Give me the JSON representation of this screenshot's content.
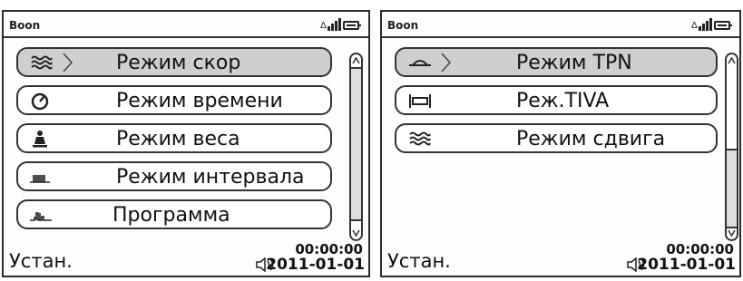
{
  "screens": [
    {
      "header": {
        "brand": "Boon"
      },
      "menu": [
        {
          "label": "Режим скор",
          "icon": "flow-waves-icon",
          "selected": true
        },
        {
          "label": "Режим времени",
          "icon": "timer-icon",
          "selected": false
        },
        {
          "label": "Режим веса",
          "icon": "person-weight-icon",
          "selected": false
        },
        {
          "label": "Режим интервала",
          "icon": "interval-chart-icon",
          "selected": false
        },
        {
          "label": "Программа",
          "icon": "program-chart-icon",
          "selected": false
        }
      ],
      "footer": {
        "softkey": "Устан.",
        "time": "00:00:00",
        "date": "2011-01-01"
      }
    },
    {
      "header": {
        "brand": "Boon"
      },
      "menu": [
        {
          "label": "Режим TPN",
          "icon": "tpn-icon",
          "selected": true
        },
        {
          "label": "Реж.TIVA",
          "icon": "tiva-icon",
          "selected": false
        },
        {
          "label": "Режим сдвига",
          "icon": "shift-waves-icon",
          "selected": false
        }
      ],
      "footer": {
        "softkey": "Устан.",
        "time": "00:00:00",
        "date": "2011-01-01"
      }
    }
  ],
  "colors": {
    "selected_bg": "#cfcfcf",
    "border": "#333333",
    "background": "#fdfdfd"
  }
}
